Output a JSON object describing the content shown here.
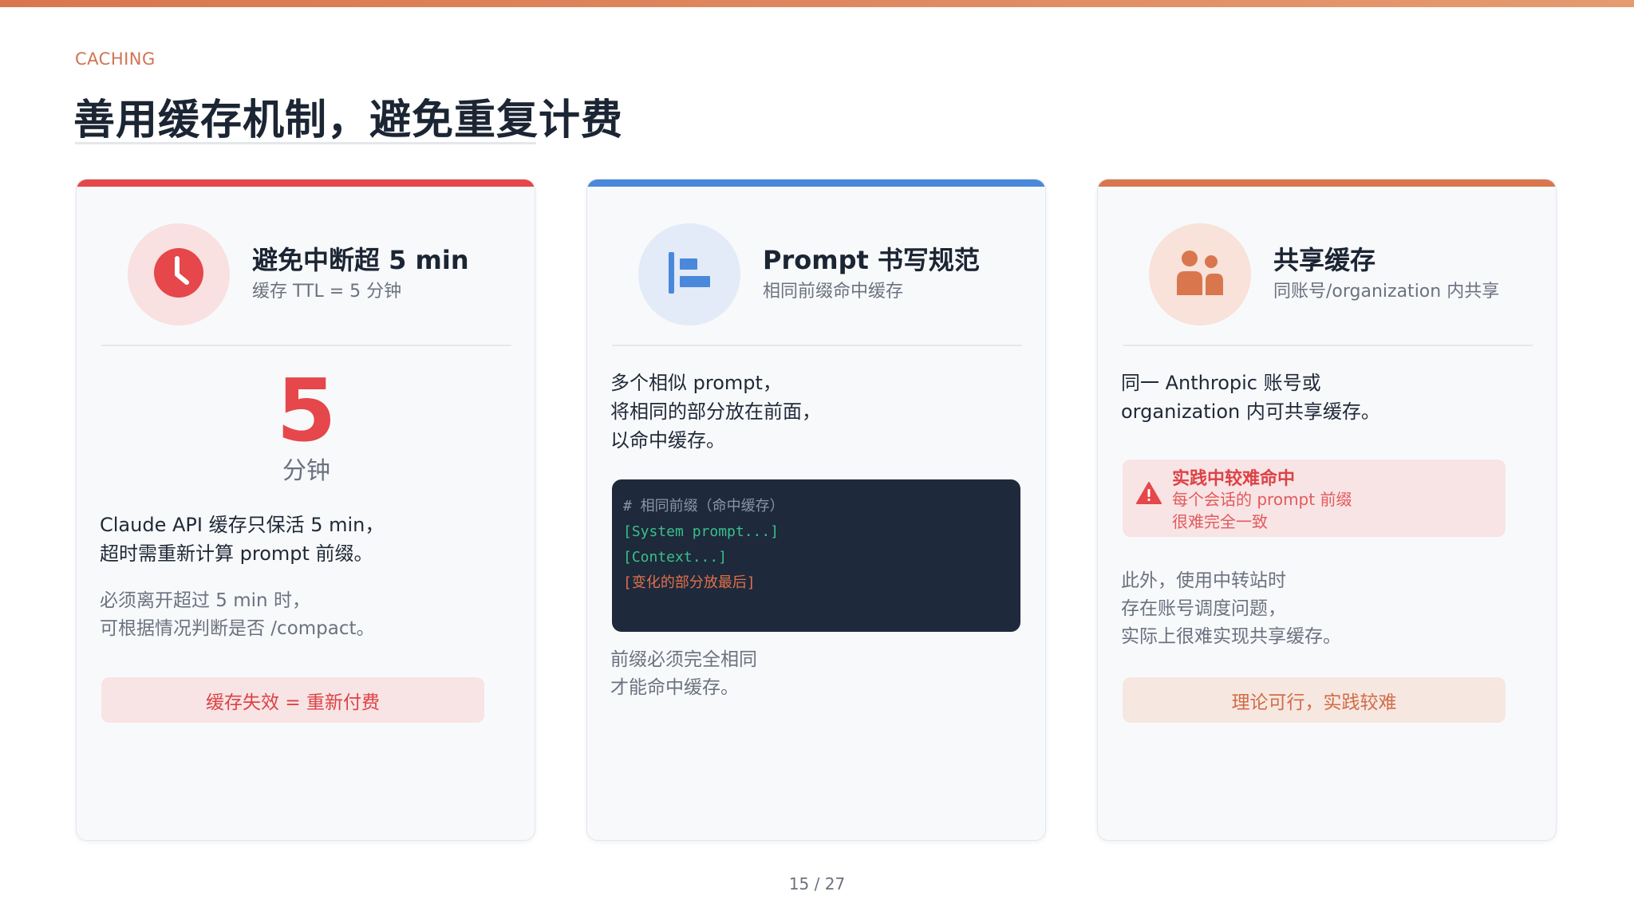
{
  "header": {
    "eyebrow": "CACHING",
    "title": "善用缓存机制，避免重复计费"
  },
  "colors": {
    "accent_red": "#e5474a",
    "accent_blue": "#4a88db",
    "accent_orange": "#d9764e",
    "code_bg": "#1e293b"
  },
  "cards": [
    {
      "icon": "clock-icon",
      "title": "避免中断超 5 min",
      "subtitle": "缓存 TTL = 5 分钟",
      "big_number": "5",
      "big_unit": "分钟",
      "body_lines": [
        "Claude API 缓存只保活 5 min，",
        "超时需重新计算 prompt 前缀。"
      ],
      "note_lines": [
        "必须离开超过 5 min 时，",
        "可根据情况判断是否 /compact。"
      ],
      "pill": "缓存失效 = 重新付费"
    },
    {
      "icon": "align-left-icon",
      "title": "Prompt 书写规范",
      "subtitle": "相同前缀命中缓存",
      "body_lines": [
        "多个相似 prompt，",
        "将相同的部分放在前面，",
        "以命中缓存。"
      ],
      "code_lines": [
        "# 相同前缀（命中缓存）",
        "[System prompt...]",
        "[Context...]",
        "[变化的部分放最后]"
      ],
      "note_lines": [
        "前缀必须完全相同",
        "才能命中缓存。"
      ]
    },
    {
      "icon": "users-icon",
      "title": "共享缓存",
      "subtitle": "同账号/organization 内共享",
      "body_lines": [
        "同一 Anthropic 账号或",
        "organization 内可共享缓存。"
      ],
      "warning_title": "实践中较难命中",
      "warning_lines": [
        "每个会话的 prompt 前缀",
        "很难完全一致"
      ],
      "note_lines": [
        "此外，使用中转站时",
        "存在账号调度问题，",
        "实际上很难实现共享缓存。"
      ],
      "pill": "理论可行，实践较难"
    }
  ],
  "footer": {
    "page": "15 / 27"
  }
}
